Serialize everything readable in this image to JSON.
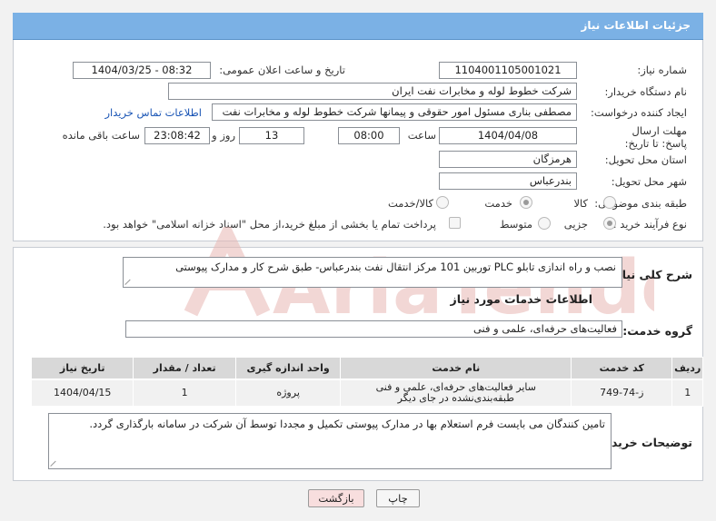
{
  "page_title": "جزئیات اطلاعات نیاز",
  "fields": {
    "need_number_label": "شماره نیاز:",
    "need_number": "1104001105001021",
    "announce_label": "تاریخ و ساعت اعلان عمومی:",
    "announce_value": "1404/03/25 - 08:32",
    "buyer_org_label": "نام دستگاه خریدار:",
    "buyer_org": "شرکت خطوط لوله و مخابرات نفت ایران",
    "creator_label": "ایجاد کننده درخواست:",
    "creator": "مصطفی بناری مسئول امور حقوقی و پیمانها  شرکت خطوط لوله و مخابرات نفت",
    "contact_link": "اطلاعات تماس خریدار",
    "deadline_label": "مهلت ارسال پاسخ: تا تاریخ:",
    "deadline_date": "1404/04/08",
    "time_label": "ساعت",
    "deadline_time": "08:00",
    "days_value": "13",
    "days_label": "روز و",
    "remaining_time": "23:08:42",
    "remaining_label": "ساعت باقی مانده",
    "province_label": "استان محل تحویل:",
    "province": "هرمزگان",
    "city_label": "شهر محل تحویل:",
    "city": "بندرعباس",
    "category_label": "طبقه بندی موضوعی:",
    "category_options": [
      "کالا",
      "خدمت",
      "کالا/خدمت"
    ],
    "category_selected": "خدمت",
    "process_label": "نوع فرآیند خرید :",
    "process_options": [
      "جزیی",
      "متوسط"
    ],
    "process_selected": "جزیی",
    "payment_note": "پرداخت تمام یا بخشی از مبلغ خرید،از محل \"اسناد خزانه اسلامی\" خواهد بود."
  },
  "description": {
    "label": "شرح کلی نیاز:",
    "text": "نصب و راه اندازی تابلو PLC توربین 101 مرکز انتقال نفت بندرعباس- طبق شرح کار و مدارک پیوستی"
  },
  "services": {
    "section_title": "اطلاعات خدمات مورد نیاز",
    "group_label": "گروه خدمت:",
    "group_value": "فعالیت‌های حرفه‌ای، علمی و فنی",
    "columns": [
      "ردیف",
      "کد خدمت",
      "نام خدمت",
      "واحد اندازه گیری",
      "تعداد / مقدار",
      "تاریخ نیاز"
    ],
    "rows": [
      [
        "1",
        "ز-74-749",
        "سایر فعالیت‌های حرفه‌ای، علمی و فنی طبقه‌بندی‌نشده در جای دیگر",
        "پروژه",
        "1",
        "1404/04/15"
      ]
    ]
  },
  "buyer_notes": {
    "label": "توضیحات خریدار:",
    "text": "تامین کنندگان می بایست فرم استعلام بها در مدارک پیوستی تکمیل و مجددا توسط آن شرکت در سامانه بارگذاری گردد."
  },
  "buttons": {
    "print": "چاپ",
    "back": "بازگشت"
  },
  "watermark": "AriaTender.net",
  "colors": {
    "header_bg": "#7bb1e5",
    "link": "#1a55b5",
    "back_button_bg": "#f8dede",
    "watermark": "#e8b7b4"
  }
}
